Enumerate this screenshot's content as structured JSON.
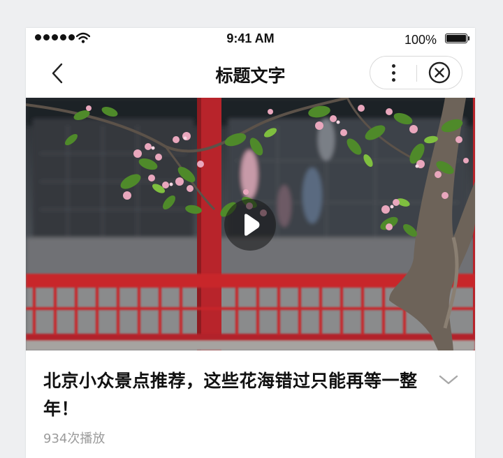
{
  "status_bar": {
    "time": "9:41 AM",
    "battery_text": "100%",
    "signal_icon": "signal-dots-icon",
    "wifi_icon": "wifi-icon",
    "battery_icon": "battery-full-icon"
  },
  "nav": {
    "title": "标题文字",
    "back_icon": "chevron-left-icon",
    "more_icon": "more-vertical-icon",
    "close_icon": "close-circle-icon"
  },
  "video": {
    "play_icon": "play-icon"
  },
  "info": {
    "title": "北京小众景点推荐，这些花海错过只能再等一整年！",
    "play_count": "934次播放",
    "expand_icon": "chevron-down-icon"
  },
  "colors": {
    "background": "#eeeff1",
    "text_primary": "#111111",
    "text_secondary": "#9b9b9b",
    "railing_red": "#c8272c"
  }
}
